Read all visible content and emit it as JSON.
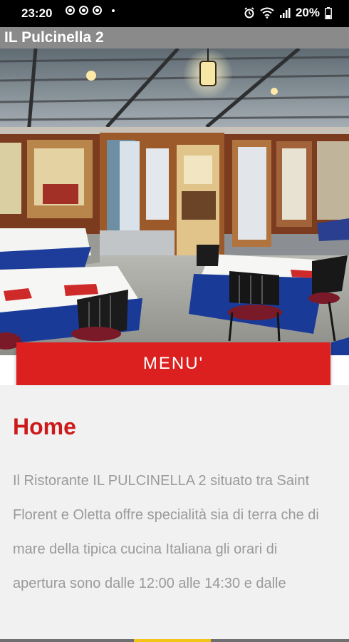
{
  "status_bar": {
    "time": "23:20",
    "battery": "20%",
    "icons": [
      "notification-icon",
      "notification-icon",
      "notification-icon",
      "alarm-icon",
      "wifi-icon",
      "signal-icon",
      "battery-icon"
    ]
  },
  "app_bar": {
    "title": "IL Pulcinella 2",
    "background": "#8a8a8a"
  },
  "hero_image": {
    "subject": "restaurant terrace with dining tables"
  },
  "menu_button": {
    "label": "MENU'",
    "color": "#dc1f1f"
  },
  "content": {
    "heading": "Home",
    "heading_color": "#cc1a1a",
    "description": "Il Ristorante IL PULCINELLA 2 situato tra Saint Florent e Oletta offre specialità sia di terra che di mare della tipica cucina Italiana gli orari di apertura sono dalle 12:00 alle 14:30 e dalle"
  },
  "bottom_indicator": {
    "color": "#f3c316"
  }
}
